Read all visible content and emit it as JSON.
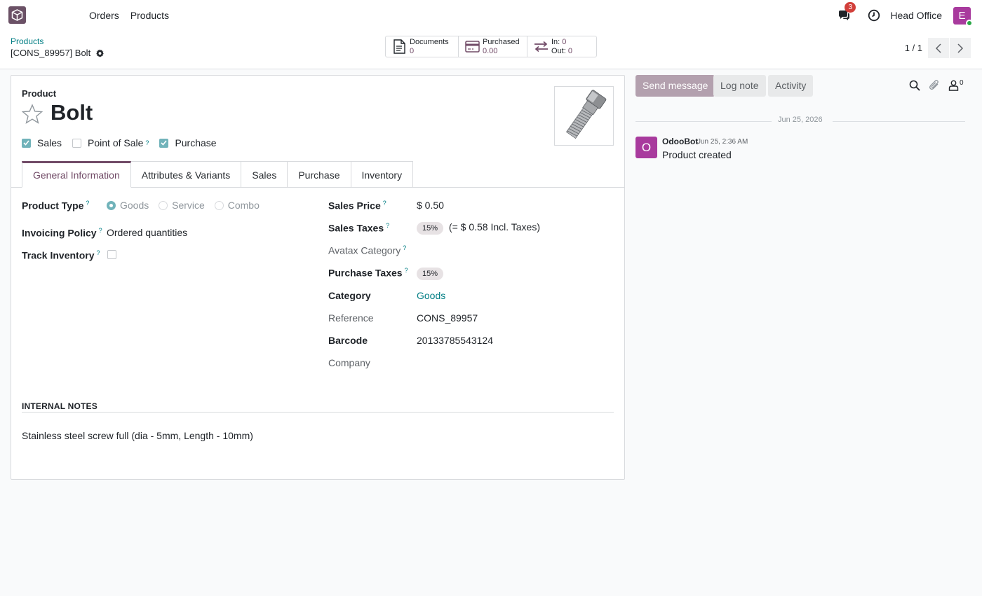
{
  "topbar": {
    "menu": [
      "Orders",
      "Products"
    ],
    "messages_count": "3",
    "company": "Head Office",
    "user_initial": "E"
  },
  "breadcrumb": {
    "parent": "Products",
    "current": "[CONS_89957] Bolt"
  },
  "smart_buttons": {
    "documents_label": "Documents",
    "documents_value": "0",
    "purchased_label": "Purchased",
    "purchased_value": "0.00",
    "in_label": "In:",
    "in_value": "0",
    "out_label": "Out:",
    "out_value": "0"
  },
  "pager": {
    "value": "1 / 1"
  },
  "product": {
    "label": "Product",
    "name": "Bolt",
    "flags": [
      {
        "label": "Sales",
        "checked": true
      },
      {
        "label": "Point of Sale",
        "checked": false
      },
      {
        "label": "Purchase",
        "checked": true
      }
    ]
  },
  "tabs": [
    "General Information",
    "Attributes & Variants",
    "Sales",
    "Purchase",
    "Inventory"
  ],
  "general": {
    "product_type_label": "Product Type",
    "product_type_options": [
      "Goods",
      "Service",
      "Combo"
    ],
    "product_type_selected": "Goods",
    "invoicing_policy_label": "Invoicing Policy",
    "invoicing_policy_value": "Ordered quantities",
    "track_inventory_label": "Track Inventory",
    "sales_price_label": "Sales Price",
    "sales_price_value": "$ 0.50",
    "sales_taxes_label": "Sales Taxes",
    "sales_taxes_badge": "15%",
    "sales_taxes_incl": "(= $ 0.58 Incl. Taxes)",
    "avatax_label": "Avatax Category",
    "purchase_taxes_label": "Purchase Taxes",
    "purchase_taxes_badge": "15%",
    "category_label": "Category",
    "category_value": "Goods",
    "reference_label": "Reference",
    "reference_value": "CONS_89957",
    "barcode_label": "Barcode",
    "barcode_value": "20133785543124",
    "company_label": "Company"
  },
  "notes": {
    "title": "INTERNAL NOTES",
    "text": "Stainless steel screw full (dia - 5mm, Length - 10mm)"
  },
  "chatter": {
    "send_message": "Send message",
    "log_note": "Log note",
    "activity": "Activity",
    "followers_count": "0",
    "date_separator": "Jun 25, 2026",
    "message": {
      "avatar_initial": "O",
      "author": "OdooBot",
      "date": "Jun 25, 2:36 AM",
      "body": "Product created"
    }
  },
  "colors": {
    "brand": "#714b67",
    "link": "#017e84",
    "badge_red": "#d23f3a",
    "avatar": "#a83a9d"
  }
}
